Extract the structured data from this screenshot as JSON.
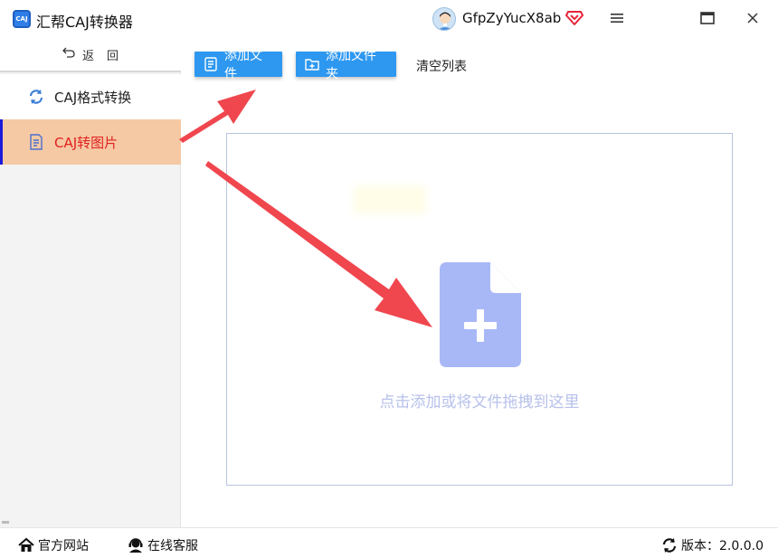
{
  "app": {
    "logo_text": "CAJ",
    "title": "汇帮CAJ转换器",
    "username": "GfpZyYucX8ab"
  },
  "sidebar": {
    "back_label": "返回",
    "items": [
      {
        "label": "CAJ格式转换",
        "icon": "refresh-icon"
      },
      {
        "label": "CAJ转图片",
        "icon": "document-icon",
        "active": true
      }
    ]
  },
  "toolbar": {
    "add_file_label": "添加文件",
    "add_folder_label": "添加文件夹",
    "clear_list_label": "清空列表"
  },
  "dropzone": {
    "hint": "点击添加或将文件拖拽到这里"
  },
  "statusbar": {
    "website_label": "官方网站",
    "service_label": "在线客服",
    "version_label": "版本：2.0.0.0"
  },
  "colors": {
    "accent_button": "#2e98f0",
    "active_item_bg": "#f5c9a4",
    "active_item_text": "#e02020",
    "arrow": "#f0464e",
    "file_icon": "#a8b8f7"
  }
}
